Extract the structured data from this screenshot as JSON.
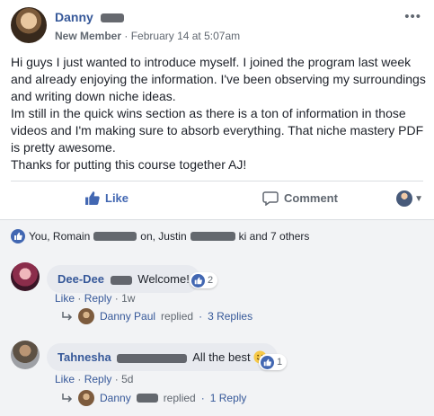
{
  "post": {
    "author_name": "Danny",
    "author_badge": "New Member",
    "timestamp": "February 14 at 5:07am",
    "body": "Hi guys I just wanted to introduce myself. I joined the program last week and already enjoying the information. I've been observing my surroundings and writing down niche ideas.\nIm still in the quick wins section as there is a ton of information in those videos and I'm making sure to absorb everything. That niche mastery PDF is pretty awesome.\nThanks for putting this course together AJ!",
    "like_label": "Like",
    "comment_label": "Comment"
  },
  "reactions": {
    "prefix": "You, Romain",
    "middle": "on, Justin",
    "suffix": "ki and 7 others"
  },
  "comments": [
    {
      "author": "Dee-Dee",
      "text": "Welcome!",
      "like_count": "2",
      "like_label": "Like",
      "reply_label": "Reply",
      "time": "1w",
      "reply_author": "Danny Paul",
      "reply_text": "replied",
      "reply_count": "3 Replies"
    },
    {
      "author": "Tahnesha",
      "text": "All the best",
      "like_count": "1",
      "like_label": "Like",
      "reply_label": "Reply",
      "time": "5d",
      "reply_author": "Danny",
      "reply_text": "replied",
      "reply_count": "1 Reply"
    }
  ],
  "ui": {
    "separator": "·",
    "options_icon": "more-options-icon",
    "like_icon": "thumbs-up-icon",
    "comment_icon": "comment-icon",
    "reply_icon": "reply-arrow-icon",
    "emoji_icon": "smiley-emoji-icon"
  },
  "colors": {
    "brand_blue": "#4267b2",
    "link_blue": "#365899",
    "comment_bg": "#f2f3f5",
    "bubble_bg": "#e8eaef",
    "muted_text": "#606770"
  }
}
